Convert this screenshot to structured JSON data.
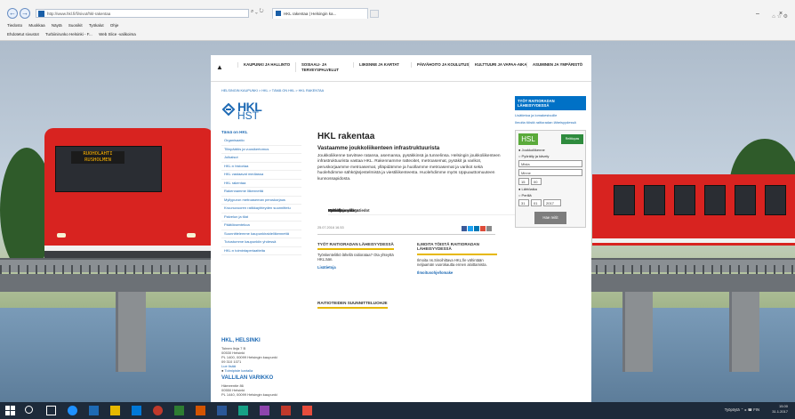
{
  "browser": {
    "url": "http://www.hkl.fi/fi/sivut/hkl-rakentaa",
    "tab_title": "HKL rakentaa | Helsingin ka...",
    "search_icons": "⌕ ⌄ ↻",
    "menu": [
      "Tiedosto",
      "Muokkaa",
      "Näytä",
      "Suosikit",
      "Työkalut",
      "Ohje"
    ],
    "favorites": [
      "Ehdotetut sivustot",
      "Turbiinirunko Helsinki - F...",
      "Web Slice -valikoima"
    ],
    "win_min": "–",
    "win_close": "×",
    "corner_icons": "⌂ ☆ ⚙"
  },
  "topnav": {
    "home_icon": "home-icon",
    "items": [
      "KAUPUNKI JA HALLINTO",
      "SOSIAALI- JA TERVEYSPALVELUT",
      "LIIKENNE JA KARTAT",
      "PÄIVÄHOITO JA KOULUTUS",
      "KULTTUURI JA VAPAA-AIKA",
      "ASUMINEN JA YMPÄRISTÖ"
    ]
  },
  "breadcrumb": "HELSINGIN KAUPUNKI > HKL > TÄMÄ ON HKL > HKL RAKENTAA",
  "logo": {
    "line1": "HKL",
    "line2": "HST"
  },
  "leftnav": {
    "head": "Tämä on HKL",
    "subitems": [
      "Organisaatio",
      "Tilinpäätös ja vuosikertomus",
      "Julkaisut",
      "HKL:n historiaa",
      "HKL vastaavat mediassa",
      "HKL rakentaa",
      "Rakennamme liikennettä",
      "Myllypuron metroaseman peruskorjaus",
      "Kruunuvuoren ratikkayhteyden suunnittelu",
      "Palvelun ja tilat",
      "Päätöksentekoa",
      "Suunnittelemme kaupunkiraideliikennettä",
      "Tutustumme kaupunkiin yhdessä",
      "HKL:n toimintaperiaatteita"
    ],
    "main": [
      "Metrolla",
      "Raitiovaunulla",
      "Lautalla",
      "Pyörällä",
      "Pääkirjeenvaihto",
      "Palaute ja yhteystiedot"
    ]
  },
  "contact": {
    "title1": "HKL, HELSINKI",
    "lines1": [
      "Toinen linja 7 B",
      "00530 Helsinki",
      "PL 1400, 00099 Helsingin kaupunki",
      "09 310 1071"
    ],
    "link1": "Lue lisää",
    "link2": "Toimipiste kartalla",
    "title2": "VALLILAN VARIKKO",
    "lines2": [
      "Hämeentie 86",
      "00550 Helsinki",
      "PL 1440, 00099 Helsingin kaupunki"
    ]
  },
  "article": {
    "title": "HKL rakentaa",
    "subtitle": "Vastaamme joukkoliikenteen infrastruktuurista",
    "body": "Joukkoliikenne tarvitsee ratansa, asemansa, pysäkkinsä ja tunnelinsa. Helsingin joukkoliikenteen infrastruktuurista vastaa HKL. Rakennamme ratteoitet, metroasemat, pysäkit ja varikot, peruskorjaamme metroasemat, ylläpidämme ja huollamme metroasemat ja varikot sekä huolehdimme sähköjärjestelmistä ja viestiliikenteesta. Huolehdimme myös Uppuauttomuuteen kunnossapidosta.",
    "date": "25.07.2016 16.53",
    "share_colors": [
      "#3b5998",
      "#1da1f2",
      "#0077b5",
      "#dd4b39",
      "#888888"
    ]
  },
  "teasers": [
    {
      "title": "TYÖT RAITIORADAN LÄHEISYYDESSÄ",
      "body": "Työskentelitkö lähellä raitiorataa? Ota yhteyttä HKL:ään.",
      "link": "Lisätietoja"
    },
    {
      "title": "ILMOITA TÖISTÄ RAITIORADAN LÄHEISYYDESSÄ",
      "body": "Ilmoita ns.Sinoihittava HKL:lle vähintään neljaamän vuorokautta ennen aloittamista.",
      "link": "Ilmoitusohje/lomake"
    },
    {
      "title": "RAITIOTEIDEN SUUNNITTELUOHJE",
      "body": "",
      "link": ""
    }
  ],
  "right": {
    "head": "TYÖT RAITIORADAN LÄHEISYYDESSÄ",
    "link1": "Lisätietoa ja lomakesivuille",
    "link2": "Ilmoita töistä raitioradan läheisyydessä",
    "brand": "HSL",
    "brand2": "Reittiopas",
    "radios": [
      "Joukkoliikenne",
      "Pyöräily ja kävely"
    ],
    "from_placeholder": "Mista",
    "to_placeholder": "Minne",
    "time_h": "15",
    "time_m": "00",
    "radios2": [
      "Lähtöaika",
      "Perillä"
    ],
    "date_d": "31",
    "date_m": "01",
    "date_y": "2017",
    "button": "Hae reitit"
  },
  "taskbar": {
    "tray_text": "Työpöytä",
    "time": "15.00",
    "date": "31.1.2017",
    "lang": "FIN"
  }
}
